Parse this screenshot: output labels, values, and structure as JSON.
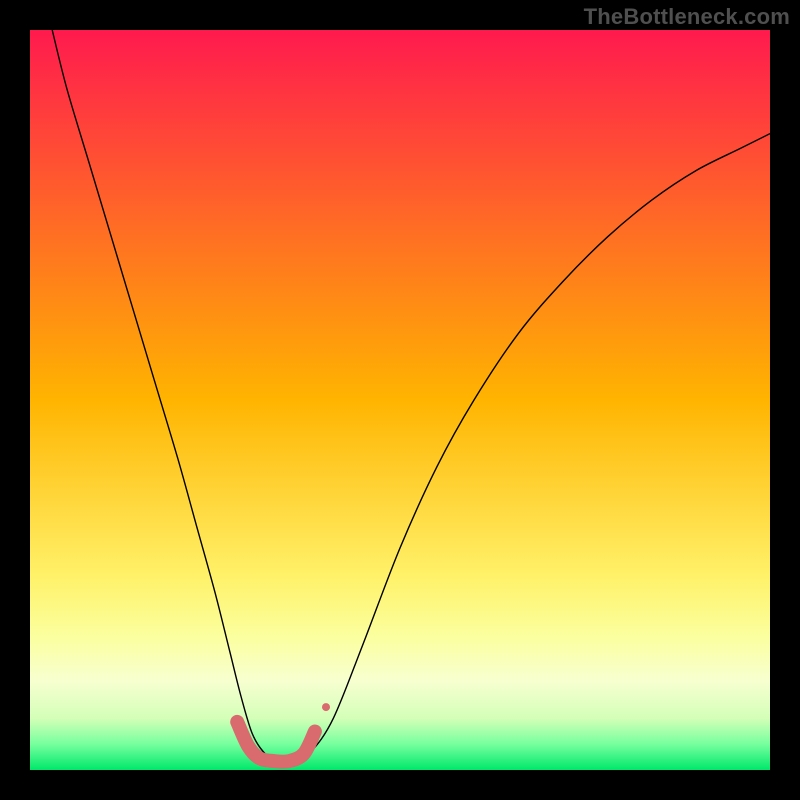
{
  "watermark": "TheBottleneck.com",
  "chart_data": {
    "type": "line",
    "title": "",
    "xlabel": "",
    "ylabel": "",
    "xlim": [
      0,
      100
    ],
    "ylim": [
      0,
      100
    ],
    "grid": false,
    "background_gradient": {
      "stops": [
        {
          "offset": 0.0,
          "color": "#ff1a4e"
        },
        {
          "offset": 0.5,
          "color": "#ffb400"
        },
        {
          "offset": 0.74,
          "color": "#fff26a"
        },
        {
          "offset": 0.82,
          "color": "#fbff9f"
        },
        {
          "offset": 0.88,
          "color": "#f7ffd0"
        },
        {
          "offset": 0.93,
          "color": "#d4ffb8"
        },
        {
          "offset": 0.965,
          "color": "#77ff9e"
        },
        {
          "offset": 1.0,
          "color": "#00e86b"
        }
      ]
    },
    "series": [
      {
        "name": "bottleneck-curve",
        "kind": "line",
        "stroke": "#000000",
        "stroke_width": 1.4,
        "x": [
          3,
          5,
          8,
          11,
          14,
          17,
          20,
          22.5,
          25,
          27,
          28.5,
          30,
          31.5,
          33,
          36,
          38,
          41,
          45,
          50,
          55,
          60,
          66,
          72,
          78,
          84,
          90,
          96,
          100
        ],
        "y": [
          100,
          92,
          82,
          72,
          62,
          52,
          42,
          33,
          24,
          16,
          10,
          5,
          2.5,
          1.5,
          1.5,
          2.5,
          7,
          17,
          30,
          41,
          50,
          59,
          66,
          72,
          77,
          81,
          84,
          86
        ]
      },
      {
        "name": "sweet-spot-band",
        "kind": "band",
        "stroke": "#d96a6d",
        "stroke_width": 14,
        "linecap": "round",
        "x": [
          28,
          29.5,
          31,
          33,
          35,
          37,
          38.5
        ],
        "y": [
          6.5,
          3.2,
          1.6,
          1.2,
          1.2,
          2.2,
          5.2
        ]
      },
      {
        "name": "sweet-spot-dot",
        "kind": "scatter",
        "marker": "circle",
        "marker_size": 8,
        "fill": "#d96a6d",
        "x": [
          40
        ],
        "y": [
          8.5
        ]
      }
    ]
  },
  "colors": {
    "frame": "#000000",
    "curve": "#000000",
    "band": "#d96a6d",
    "watermark": "#4f4f4f"
  }
}
